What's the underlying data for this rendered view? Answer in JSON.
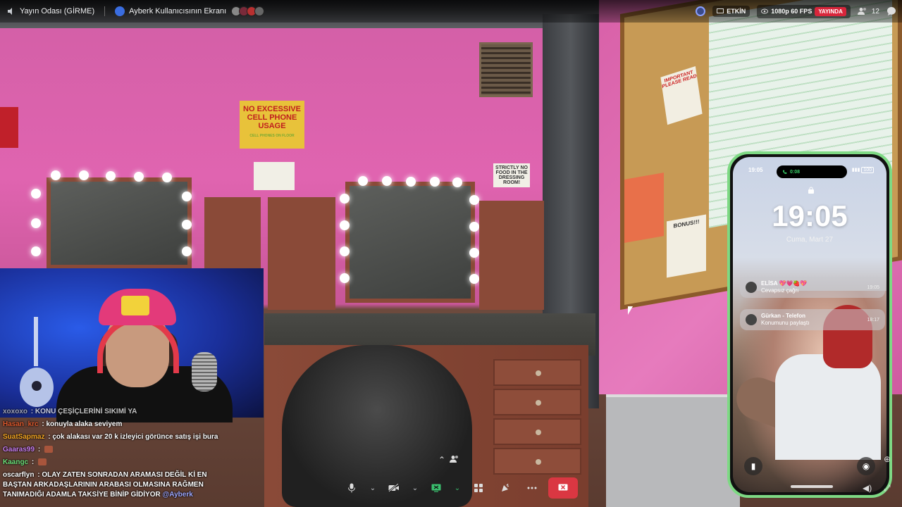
{
  "topbar": {
    "channel": "Yayın Odası (GİRME)",
    "screen_share": "Ayberk Kullanıcısının Ekranı",
    "status": "ETKİN",
    "quality": "1080p 60 FPS",
    "live": "YAYINDA",
    "viewers": "12"
  },
  "scene_signs": {
    "yellow": "NO EXCESSIVE CELL PHONE USAGE",
    "yellow_sub": "CELL PHONES ON FLOOR",
    "strictly": "STRICTLY NO FOOD IN THE DRESSING ROOM!",
    "important": "IMPORTANT PLEASE READ",
    "bonus": "BONUS!!!"
  },
  "chat": {
    "messages": [
      {
        "user": "xoxoxo",
        "color": "#c9c9c9",
        "text": "KONU ÇEŞİÇLERİNİ SIKIMİ YA"
      },
      {
        "user": "Hasan_krc",
        "color": "#e05a2e",
        "text": "konuyla alaka seviyem"
      },
      {
        "user": "SuatSapmaz",
        "color": "#f5a623",
        "text": "çok alakası var 20 k izleyici görünce satış işi bura"
      },
      {
        "user": "Gaaras99",
        "color": "#c97ef0",
        "text": ""
      },
      {
        "user": "Kaangc",
        "color": "#6ee07a",
        "text": ""
      },
      {
        "user": "oscarflyn",
        "color": "#ffffff",
        "text": "OLAY ZATEN SONRADAN ARAMASI DEĞİL Kİ EN BAŞTAN ARKADAŞLARININ ARABASI OLMASINA RAĞMEN TANIMADIĞI ADAMLA TAKSİYE BİNİP GİDİYOR",
        "mention": "@Ayberk"
      }
    ]
  },
  "phone": {
    "status_time": "19:05",
    "call_timer": "0:08",
    "battery": "100",
    "big_time": "19:05",
    "date": "Cuma, Mart 27",
    "notifications": [
      {
        "title": "ELİSA 💖💗🍓💖",
        "body": "Cevapsız çağrı",
        "time": "19:05"
      },
      {
        "title": "Gürkan - Telefon",
        "body": "Konumunu paylaştı",
        "time": "18:17"
      }
    ]
  },
  "controls": {
    "mic": "microphone-icon",
    "camera": "camera-off-icon",
    "share": "screen-share-icon",
    "activities": "activities-icon",
    "soundboard": "soundboard-icon",
    "more": "more-icon",
    "end": "end-call-icon"
  },
  "colors": {
    "live_red": "#d8263b",
    "end_call_red": "#da3742",
    "phone_border": "#7ed984",
    "share_green": "#3ac06e"
  }
}
